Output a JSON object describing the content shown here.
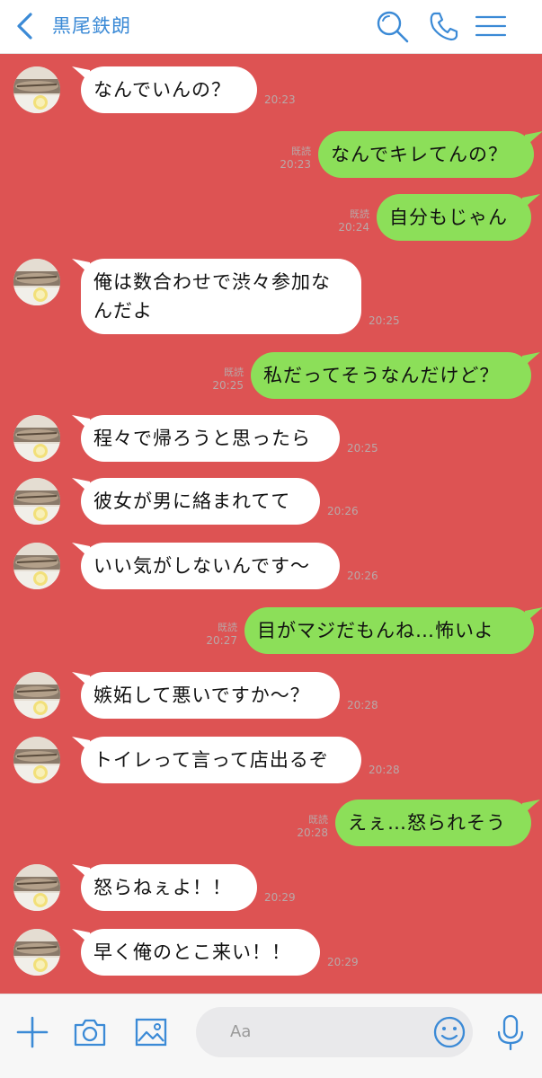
{
  "header": {
    "title": "黒尾鉄朗"
  },
  "colors": {
    "background": "#dd5353",
    "incoming": "#ffffff",
    "outgoing": "#8cdf59",
    "accent": "#3b8ad6"
  },
  "icons": [
    "back-icon",
    "search-icon",
    "phone-icon",
    "menu-icon",
    "plus-icon",
    "camera-icon",
    "image-icon",
    "emoji-icon",
    "mic-icon"
  ],
  "read_label": "既読",
  "messages": [
    {
      "dir": "in",
      "lines": [
        "なんでいんの？"
      ],
      "time": "20:23"
    },
    {
      "dir": "out",
      "lines": [
        "なんでキレてんの？"
      ],
      "time": "20:23",
      "read": "既読"
    },
    {
      "dir": "out",
      "lines": [
        "自分もじゃん"
      ],
      "time": "20:24",
      "read": "既読"
    },
    {
      "dir": "in",
      "lines": [
        "俺は数合わせで渋々参加な",
        "んだよ"
      ],
      "time": "20:25"
    },
    {
      "dir": "out",
      "lines": [
        "私だってそうなんだけど？"
      ],
      "time": "20:25",
      "read": "既読"
    },
    {
      "dir": "in",
      "lines": [
        "程々で帰ろうと思ったら"
      ],
      "time": "20:25"
    },
    {
      "dir": "in",
      "lines": [
        "彼女が男に絡まれてて"
      ],
      "time": "20:26"
    },
    {
      "dir": "in",
      "lines": [
        "いい気がしないんです〜"
      ],
      "time": "20:26"
    },
    {
      "dir": "out",
      "lines": [
        "目がマジだもんね…怖いよ"
      ],
      "time": "20:27",
      "read": "既読"
    },
    {
      "dir": "in",
      "lines": [
        "嫉妬して悪いですか〜？"
      ],
      "time": "20:28"
    },
    {
      "dir": "in",
      "lines": [
        "トイレって言って店出るぞ"
      ],
      "time": "20:28"
    },
    {
      "dir": "out",
      "lines": [
        "えぇ…怒られそう"
      ],
      "time": "20:28",
      "read": "既読"
    },
    {
      "dir": "in",
      "lines": [
        "怒らねぇよ！！"
      ],
      "time": "20:29"
    },
    {
      "dir": "in",
      "lines": [
        "早く俺のとこ来い！！"
      ],
      "time": "20:29"
    }
  ],
  "input": {
    "placeholder": "Aa"
  }
}
